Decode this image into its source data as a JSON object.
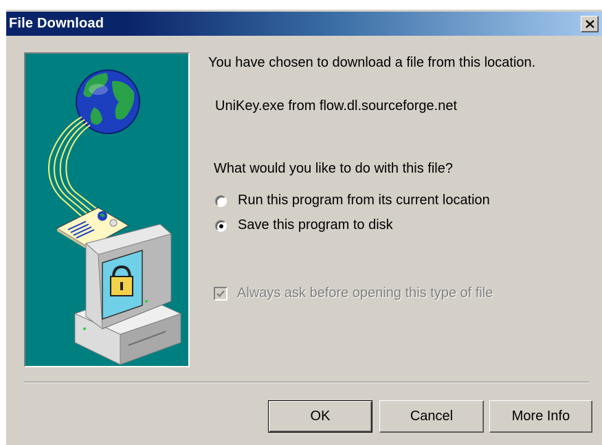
{
  "window": {
    "title": "File Download",
    "close_symbol": "×"
  },
  "dialog": {
    "intro": "You have chosen to download a file from this location.",
    "file_info": "UniKey.exe from flow.dl.sourceforge.net",
    "question": "What would you like to do with this file?",
    "options": [
      {
        "label": "Run this program from its current location",
        "selected": false
      },
      {
        "label": "Save this program to disk",
        "selected": true
      }
    ],
    "always_ask": {
      "label": "Always ask before opening this type of file",
      "checked": true,
      "enabled": false
    }
  },
  "buttons": {
    "ok": "OK",
    "cancel": "Cancel",
    "more_info": "More Info"
  },
  "colors": {
    "illustration_bg": "#007f80",
    "dialog_bg": "#d4d0c8",
    "title_start": "#0a246a",
    "title_end": "#a6caf0"
  },
  "icons": [
    "globe-icon",
    "network-cable-icon",
    "document-icon",
    "computer-icon",
    "padlock-icon",
    "close-icon",
    "checkmark-icon"
  ]
}
